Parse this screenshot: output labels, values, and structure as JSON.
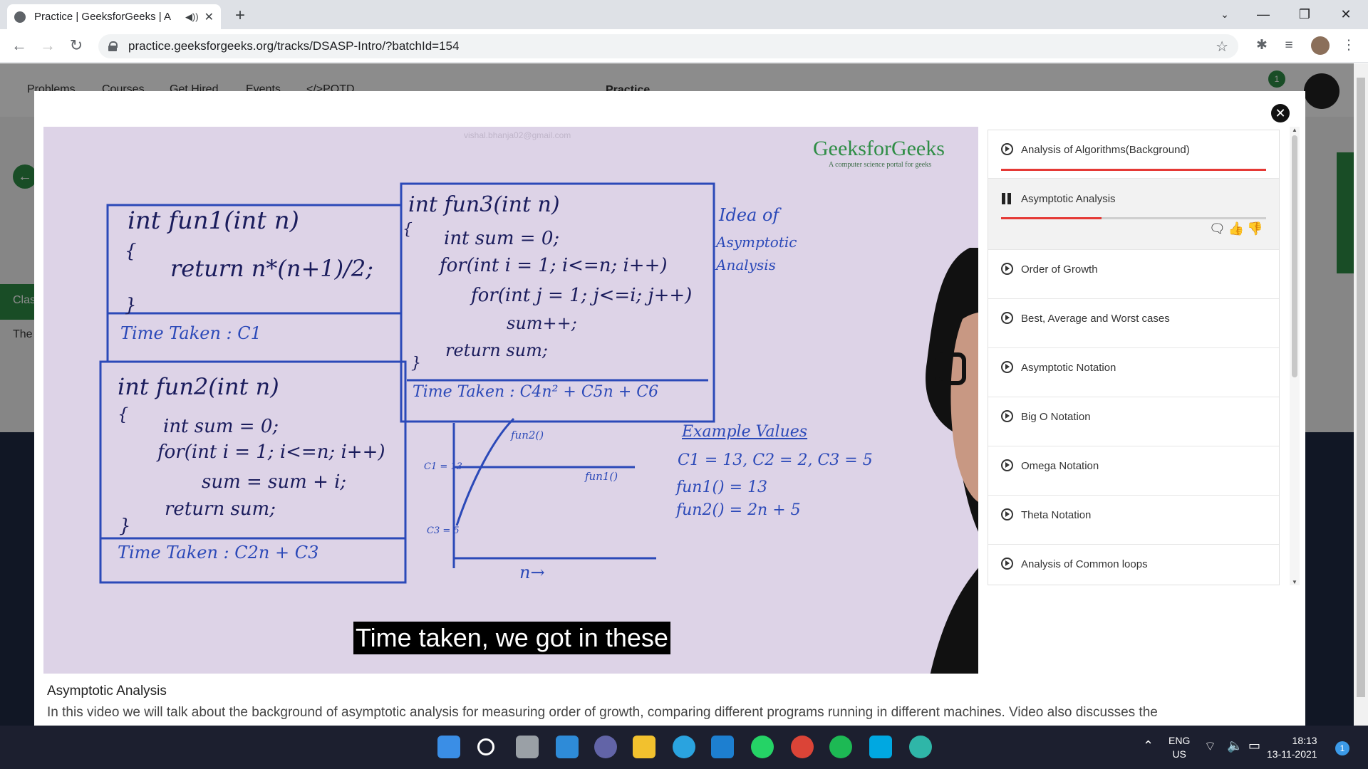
{
  "browser": {
    "tab_title": "Practice | GeeksforGeeks | A",
    "url": "practice.geeksforgeeks.org/tracks/DSASP-Intro/?batchId=154",
    "new_tab": "+",
    "minimize": "—",
    "maximize": "❐",
    "close": "✕"
  },
  "page": {
    "nav": [
      "Problems",
      "Courses",
      "Get Hired",
      "Events",
      "</>POTD"
    ],
    "logo": "Practice",
    "side_tab1": "Clas",
    "side_tab2": "The",
    "notif_count": "1"
  },
  "modal": {
    "video": {
      "email": "vishal.bhanja02@gmail.com",
      "logo": "GeeksforGeeks",
      "tagline": "A computer science portal for geeks",
      "board": {
        "fun1": [
          "int fun1(int n)",
          "{",
          "return n*(n+1)/2;",
          "}",
          "Time Taken : C1"
        ],
        "fun2": [
          "int fun2(int n)",
          "{",
          "int sum = 0;",
          "for(int i = 1; i<=n; i++)",
          "sum = sum + i;",
          "return sum;",
          "}",
          "Time Taken : C2n + C3"
        ],
        "fun3": [
          "int fun3(int n)",
          "{",
          "int sum = 0;",
          "for(int i = 1; i<=n; i++)",
          "for(int j = 1; j<=i; j++)",
          "sum++;",
          "return sum;",
          "}",
          "Time Taken : C4n² + C5n + C6"
        ],
        "idea": [
          "Idea of",
          "Asymptotic",
          "Analysis"
        ],
        "graph": {
          "fun2": "fun2()",
          "fun1": "fun1()",
          "c1": "C1 = 13",
          "c3": "C3 = 5",
          "axis": "n→"
        },
        "example": [
          "Example Values",
          "C1 = 13, C2 = 2, C3 = 5",
          "fun1() = 13",
          "fun2() = 2n + 5"
        ]
      },
      "subtitle": "Time taken, we got in these"
    },
    "playlist": [
      {
        "label": "Analysis of Algorithms(Background)",
        "state": "done"
      },
      {
        "label": "Asymptotic Analysis",
        "state": "playing",
        "progress": 0.38
      },
      {
        "label": "Order of Growth",
        "state": "idle"
      },
      {
        "label": "Best, Average and Worst cases",
        "state": "idle"
      },
      {
        "label": "Asymptotic Notation",
        "state": "idle"
      },
      {
        "label": "Big O Notation",
        "state": "idle"
      },
      {
        "label": "Omega Notation",
        "state": "idle"
      },
      {
        "label": "Theta Notation",
        "state": "idle"
      },
      {
        "label": "Analysis of Common loops",
        "state": "idle"
      }
    ],
    "description": {
      "title": "Asymptotic Analysis",
      "body": "In this video we will talk about the background of asymptotic analysis for measuring order of growth, comparing different programs running in different machines. Video also discusses the"
    }
  },
  "taskbar": {
    "lang_top": "ENG",
    "lang_bottom": "US",
    "time": "18:13",
    "date": "13-11-2021",
    "notifications": "1"
  },
  "colors": {
    "gfg_green": "#2f8d46",
    "progress_red": "#e53935",
    "whiteboard": "#ddd3e7"
  }
}
